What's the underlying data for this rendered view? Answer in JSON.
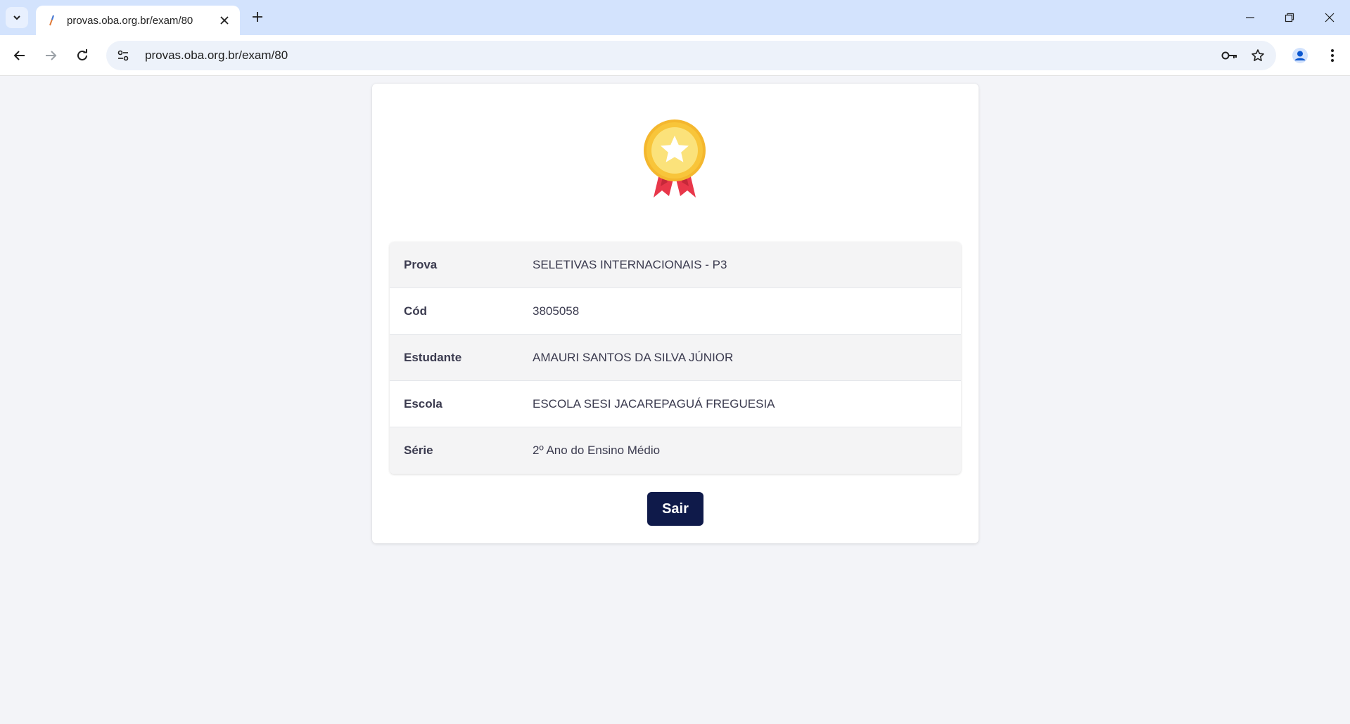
{
  "browser": {
    "tab_title": "provas.oba.org.br/exam/80",
    "url": "provas.oba.org.br/exam/80"
  },
  "exam": {
    "rows": [
      {
        "label": "Prova",
        "value": "SELETIVAS INTERNACIONAIS - P3"
      },
      {
        "label": "Cód",
        "value": "3805058"
      },
      {
        "label": "Estudante",
        "value": "AMAURI SANTOS DA SILVA JÚNIOR"
      },
      {
        "label": "Escola",
        "value": "ESCOLA SESI JACAREPAGUÁ FREGUESIA"
      },
      {
        "label": "Série",
        "value": "2º Ano do Ensino Médio"
      }
    ],
    "exit_label": "Sair"
  },
  "colors": {
    "button_bg": "#0f1a4a",
    "medal_gold": "#f8c53a",
    "ribbon_red": "#e8374a"
  }
}
